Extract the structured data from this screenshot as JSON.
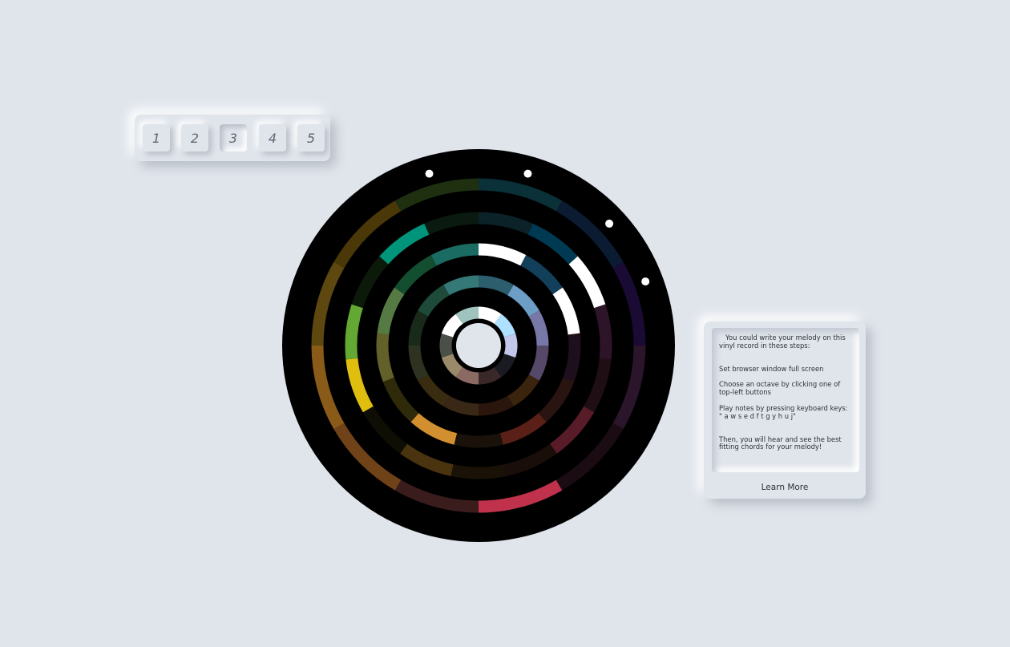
{
  "octaves": {
    "buttons": [
      "1",
      "2",
      "3",
      "4",
      "5"
    ],
    "selected_index": 2
  },
  "vinyl": {
    "colors": {
      "disc": "#000000",
      "center": "#e0e5ec",
      "marker": "#ffffff"
    },
    "rings": [
      {
        "segments": [
          "#0a3038",
          "#0b1c32",
          "#1a0b34",
          "#2a152b",
          "#1a0c12",
          "#c0324b",
          "#3b1c1c",
          "#6f4218",
          "#8a5a18",
          "#5e4810",
          "#4a3808",
          "#1e3010"
        ]
      },
      {
        "segments": [
          "#0a2228",
          "#003a52",
          "#ffffff",
          "#2e1428",
          "#1f0e14",
          "#581c28",
          "#1a0e0a",
          "#1a1206",
          "#4a3410",
          "#0f0e04",
          "#e0be10",
          "#62a832",
          "#0c1a0a",
          "#00947a",
          "#0a1a10"
        ]
      },
      {
        "segments": [
          "#ffffff",
          "#123f5a",
          "#ffffff",
          "#1e0f1c",
          "#2a1412",
          "#5a2018",
          "#1a120a",
          "#d18f30",
          "#2e2a0a",
          "#62612a",
          "#557a44",
          "#144e30",
          "#1a6c62"
        ]
      },
      {
        "segments": [
          "#2c5e6e",
          "#6c9ec6",
          "#7878a8",
          "#564868",
          "#3b240e",
          "#2a160c",
          "#3a2816",
          "#3a2c10",
          "#2e3220",
          "#1a2a1a",
          "#1e4a3a",
          "#357878"
        ]
      },
      {
        "segments": [
          "#ffffff",
          "#ade1ff",
          "#c2c6ea",
          "#1a1a22",
          "#3a2828",
          "#8a6a62",
          "#9a8a6a",
          "#4a5048",
          "#ffffff",
          "#9fc4c0"
        ]
      }
    ],
    "markers": [
      {
        "angle": -16
      },
      {
        "angle": 16
      },
      {
        "angle": 47
      },
      {
        "angle": 69
      }
    ]
  },
  "info": {
    "intro": "You could write your melody on this vinyl record in these steps:",
    "steps": [
      "Set browser window full screen",
      "Choose an octave by clicking one of top-left buttons",
      "Play notes by pressing keyboard keys: \" a w s e d f t g y h u j\"",
      "Then, you will hear and see the best fitting chords for your melody!"
    ],
    "learn_more": "Learn More"
  }
}
